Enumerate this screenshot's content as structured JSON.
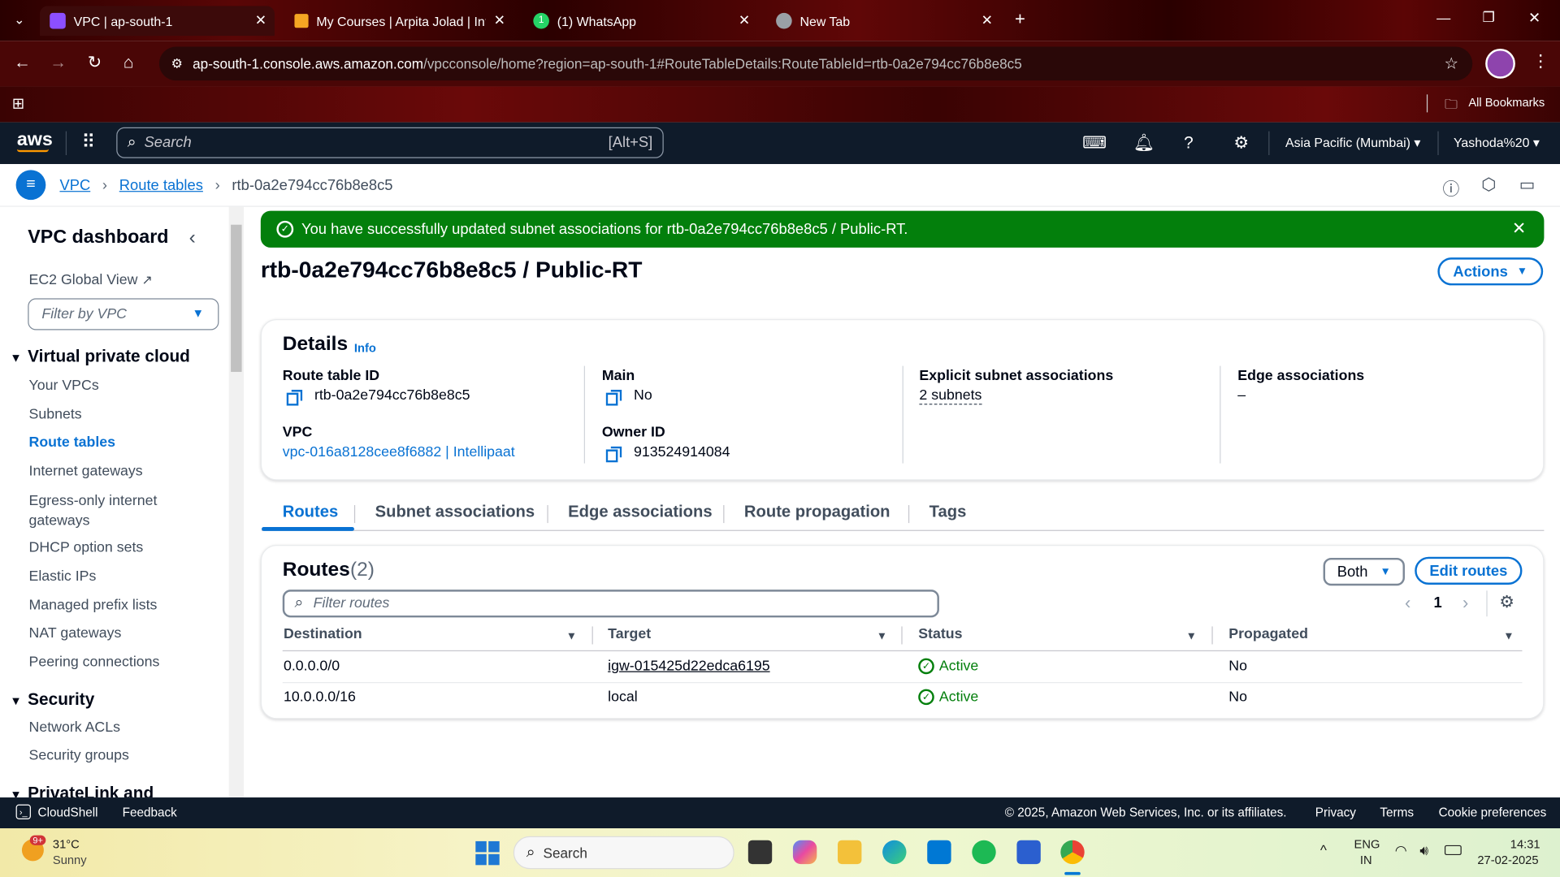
{
  "browser": {
    "tabs": [
      {
        "title": "VPC | ap-south-1",
        "active": true
      },
      {
        "title": "My Courses | Arpita Jolad | Intel",
        "active": false
      },
      {
        "title": "(1) WhatsApp",
        "active": false
      },
      {
        "title": "New Tab",
        "active": false
      }
    ],
    "url_host": "ap-south-1.console.aws.amazon.com",
    "url_path": "/vpcconsole/home?region=ap-south-1#RouteTableDetails:RouteTableId=rtb-0a2e794cc76b8e8c5",
    "bookmarks_label": "All Bookmarks",
    "whatsapp_badge": "1"
  },
  "aws_nav": {
    "logo": "aws",
    "search_placeholder": "Search",
    "search_shortcut": "[Alt+S]",
    "region": "Asia Pacific (Mumbai)",
    "account": "Yashoda%20"
  },
  "breadcrumb": [
    "VPC",
    "Route tables",
    "rtb-0a2e794cc76b8e8c5"
  ],
  "sidebar": {
    "title": "VPC dashboard",
    "ec2_global_view": "EC2 Global View",
    "filter_placeholder": "Filter by VPC",
    "sections": [
      {
        "label": "Virtual private cloud",
        "items": [
          "Your VPCs",
          "Subnets",
          "Route tables",
          "Internet gateways",
          "Egress-only internet gateways",
          "DHCP option sets",
          "Elastic IPs",
          "Managed prefix lists",
          "NAT gateways",
          "Peering connections"
        ]
      },
      {
        "label": "Security",
        "items": [
          "Network ACLs",
          "Security groups"
        ]
      },
      {
        "label": "PrivateLink and",
        "items": []
      }
    ],
    "active_item": "Route tables"
  },
  "flash": {
    "message": "You have successfully updated subnet associations for rtb-0a2e794cc76b8e8c5 / Public-RT."
  },
  "page": {
    "title": "rtb-0a2e794cc76b8e8c5 / Public-RT",
    "actions_label": "Actions"
  },
  "details": {
    "heading": "Details",
    "info": "Info",
    "route_table_id_label": "Route table ID",
    "route_table_id": "rtb-0a2e794cc76b8e8c5",
    "main_label": "Main",
    "main": "No",
    "explicit_label": "Explicit subnet associations",
    "explicit": "2 subnets",
    "edge_label": "Edge associations",
    "edge": "–",
    "vpc_label": "VPC",
    "vpc": "vpc-016a8128cee8f6882 | Intellipaat",
    "owner_label": "Owner ID",
    "owner": "913524914084"
  },
  "tabs": [
    "Routes",
    "Subnet associations",
    "Edge associations",
    "Route propagation",
    "Tags"
  ],
  "routes": {
    "title": "Routes",
    "count": "(2)",
    "filter_placeholder": "Filter routes",
    "both_label": "Both",
    "edit_label": "Edit routes",
    "page": "1",
    "columns": [
      "Destination",
      "Target",
      "Status",
      "Propagated"
    ],
    "rows": [
      {
        "destination": "0.0.0.0/0",
        "target": "igw-015425d22edca6195",
        "target_link": true,
        "status": "Active",
        "propagated": "No"
      },
      {
        "destination": "10.0.0.0/16",
        "target": "local",
        "target_link": false,
        "status": "Active",
        "propagated": "No"
      }
    ]
  },
  "footer": {
    "cloudshell": "CloudShell",
    "feedback": "Feedback",
    "copyright": "© 2025, Amazon Web Services, Inc. or its affiliates.",
    "privacy": "Privacy",
    "terms": "Terms",
    "cookies": "Cookie preferences"
  },
  "taskbar": {
    "temp": "31°C",
    "weather": "Sunny",
    "weather_badge": "9+",
    "search": "Search",
    "lang1": "ENG",
    "lang2": "IN",
    "time": "14:31",
    "date": "27-02-2025"
  },
  "colors": {
    "aws_nav": "#0f1b2a",
    "link": "#0972d3",
    "success": "#037f0c"
  }
}
